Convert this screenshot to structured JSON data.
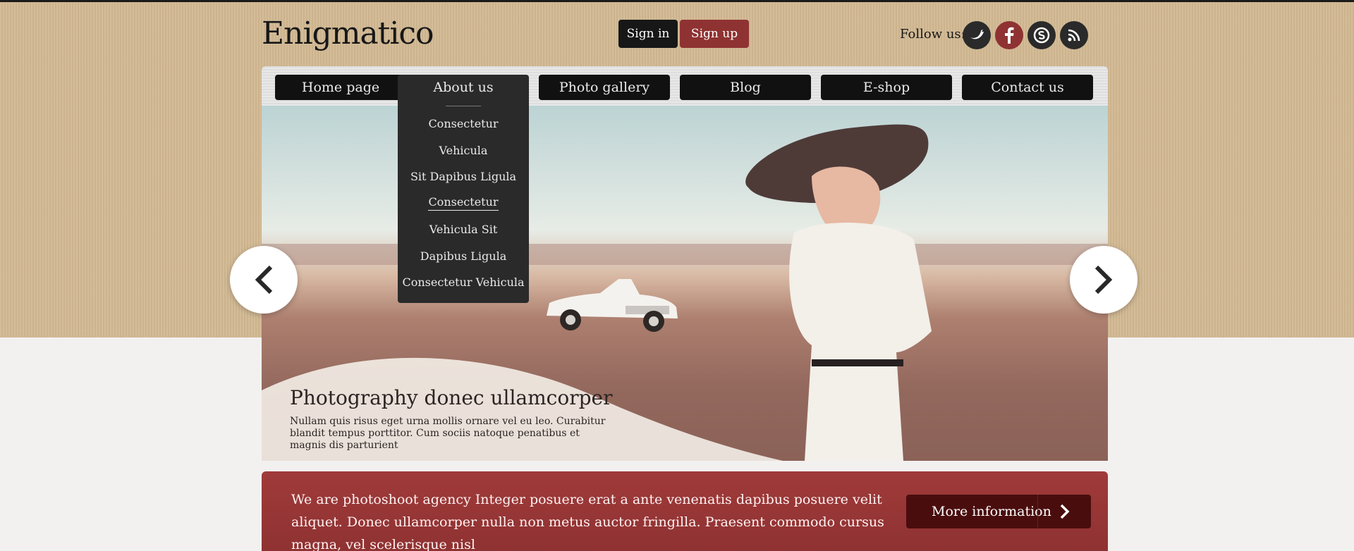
{
  "header": {
    "logo": "Enigmatico",
    "sign_in": "Sign in",
    "sign_up": "Sign up",
    "follow_label": "Follow us:",
    "social": [
      "twitter-icon",
      "facebook-icon",
      "skype-icon",
      "rss-icon"
    ]
  },
  "nav": {
    "items": [
      {
        "label": "Home page"
      },
      {
        "label": "About us"
      },
      {
        "label": "Photo gallery"
      },
      {
        "label": "Blog"
      },
      {
        "label": "E-shop"
      },
      {
        "label": "Contact us"
      }
    ],
    "dropdown": [
      "Consectetur",
      "Vehicula",
      "Sit Dapibus Ligula",
      "Consectetur",
      "Vehicula Sit",
      "Dapibus Ligula",
      "Consectetur Vehicula"
    ]
  },
  "slider": {
    "title": "Photography donec ullamcorper",
    "text": "Nullam quis risus eget urna mollis ornare vel eu leo. Curabitur blandit tempus porttitor. Cum sociis natoque penatibus et magnis dis parturient"
  },
  "banner": {
    "text": "We are photoshoot agency Integer posuere erat a ante venenatis dapibus posuere velit aliquet. Donec ullamcorper nulla non metus auctor fringilla. Praesent commodo cursus magna, vel scelerisque nisl",
    "button": "More information"
  },
  "colors": {
    "dark": "#171717",
    "signup": "#8f3232",
    "nav_bg": "#111111",
    "nav_text": "#eaeaea",
    "arrow_bg": "#ffffff",
    "arrow_icon": "#282828",
    "banner_accent": "#d15252"
  }
}
